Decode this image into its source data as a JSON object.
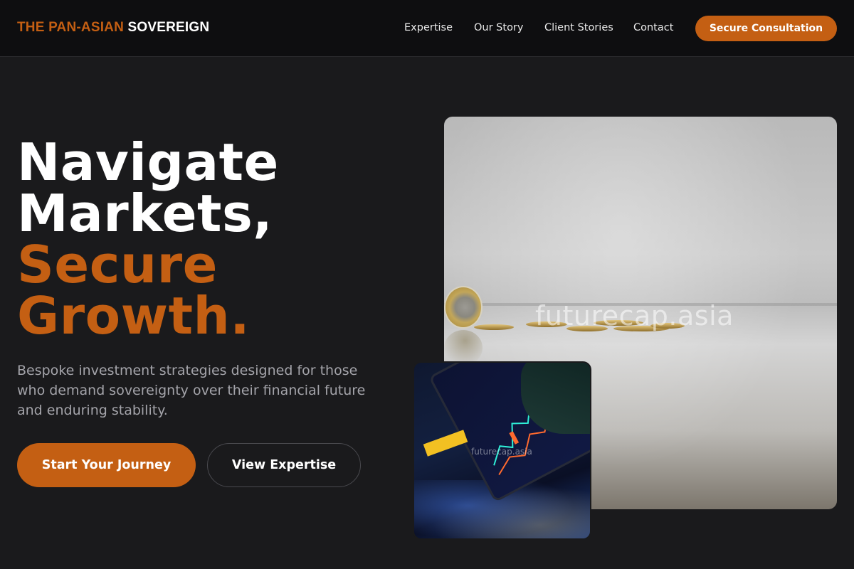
{
  "brand": {
    "accent": "THE PAN-ASIAN",
    "name": "SOVEREIGN",
    "accent_color": "#c45f13"
  },
  "nav": {
    "items": [
      "Expertise",
      "Our Story",
      "Client Stories",
      "Contact"
    ],
    "cta": "Secure Consultation"
  },
  "hero": {
    "headline_lines": [
      "Navigate",
      "Markets,"
    ],
    "headline_accent_lines": [
      "Secure",
      "Growth."
    ],
    "subtext": "Bespoke investment strategies designed for those who demand sovereignty over their financial future and enduring stability.",
    "primary_button": "Start Your Journey",
    "secondary_button": "View Expertise"
  },
  "images": {
    "main_watermark": "futurecap.asia",
    "small_watermark": "futurecap.asia"
  }
}
